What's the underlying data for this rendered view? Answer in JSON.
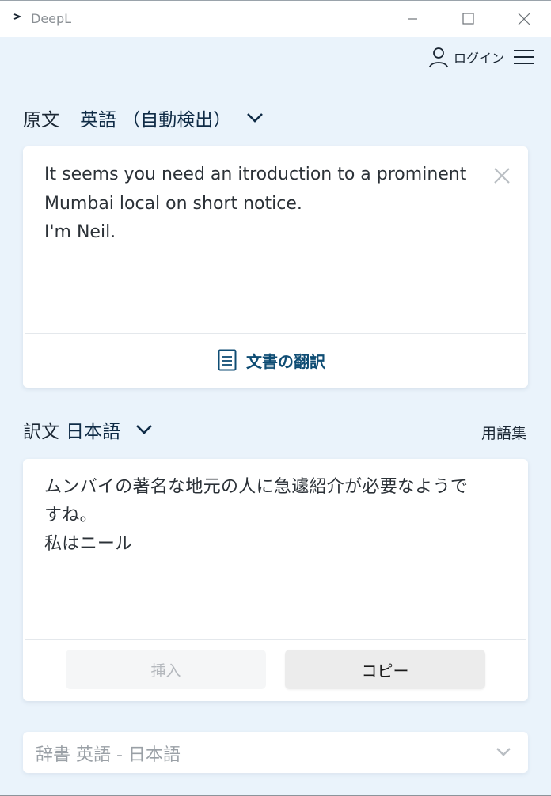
{
  "window": {
    "title": "DeepL"
  },
  "header": {
    "login_label": "ログイン"
  },
  "source": {
    "label": "原文",
    "language": "英語 （自動検出）",
    "text": "It seems you need an itroduction to a prominent\nMumbai local on short notice.\nI'm Neil.",
    "doc_translate_label": "文書の翻訳"
  },
  "target": {
    "label": "訳文",
    "language": "日本語",
    "glossary_label": "用語集",
    "text": "ムンバイの著名な地元の人に急遽紹介が必要なようで\nすね。\n私はニール",
    "insert_label": "挿入",
    "copy_label": "コピー"
  },
  "dictionary": {
    "label": "辞書 英語 - 日本語"
  },
  "colors": {
    "background": "#eaf3fb",
    "accent": "#0f4d74",
    "text": "#1a2633"
  },
  "icons": {
    "logo": "deepl-logo-icon",
    "user": "user-icon",
    "menu": "hamburger-menu-icon",
    "chevron": "chevron-down-icon",
    "clear": "close-icon",
    "document": "document-icon"
  }
}
